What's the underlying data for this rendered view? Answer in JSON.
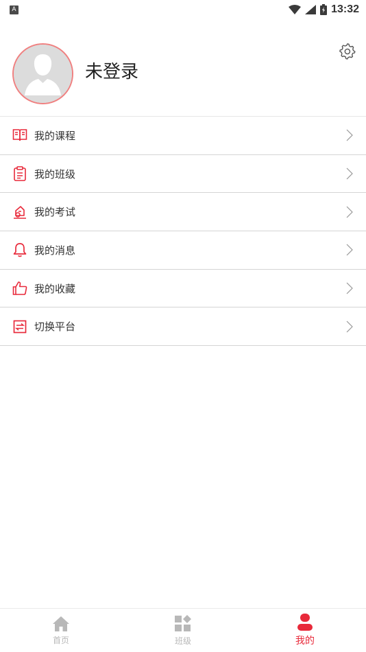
{
  "status_bar": {
    "left_icon_letter": "A",
    "time": "13:32"
  },
  "profile": {
    "login_text": "未登录",
    "avatar_icon": "user-silhouette-icon",
    "settings_icon": "gear-icon"
  },
  "menu": {
    "items": [
      {
        "label": "我的课程",
        "icon": "book-icon"
      },
      {
        "label": "我的班级",
        "icon": "clipboard-icon"
      },
      {
        "label": "我的考试",
        "icon": "exam-icon"
      },
      {
        "label": "我的消息",
        "icon": "bell-icon"
      },
      {
        "label": "我的收藏",
        "icon": "thumbs-up-icon"
      },
      {
        "label": "切换平台",
        "icon": "switch-icon"
      }
    ]
  },
  "bottom_nav": {
    "items": [
      {
        "label": "首页",
        "icon": "home-icon",
        "active": false
      },
      {
        "label": "班级",
        "icon": "grid-icon",
        "active": false
      },
      {
        "label": "我的",
        "icon": "person-icon",
        "active": true
      }
    ]
  },
  "colors": {
    "accent": "#e8293a",
    "inactive": "#b8b8b8",
    "divider": "#d4d4d4"
  }
}
